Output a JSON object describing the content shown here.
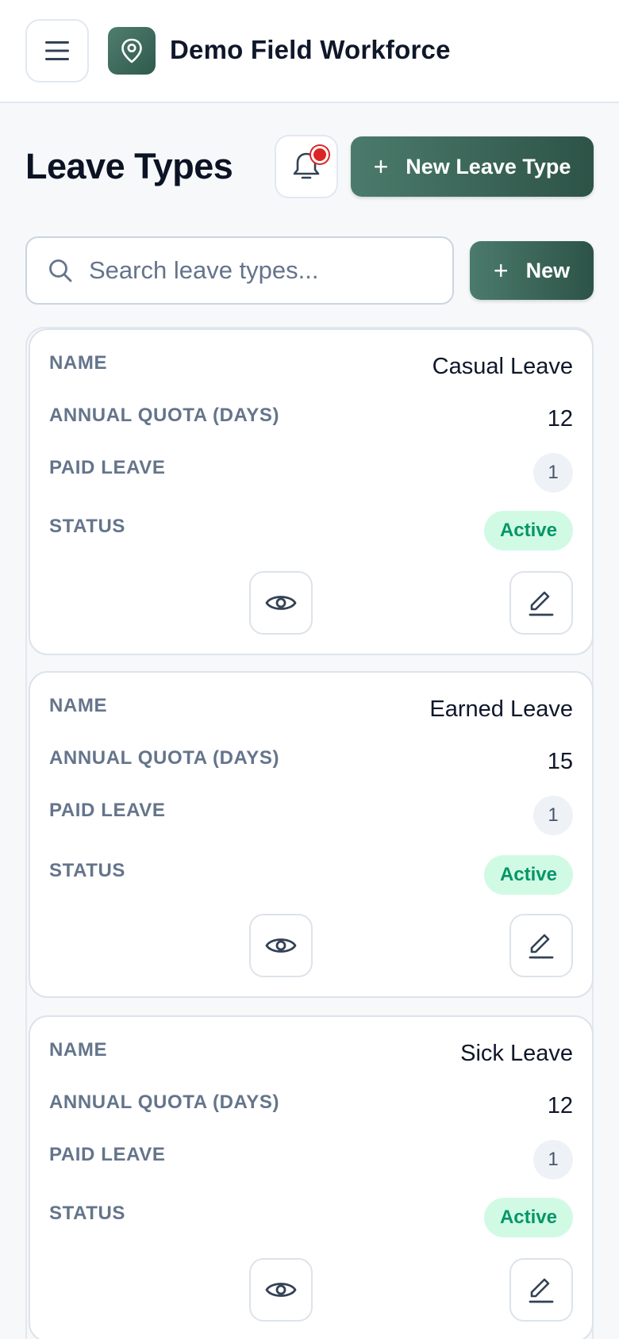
{
  "header": {
    "app_name": "Demo Field Workforce"
  },
  "page": {
    "title": "Leave Types",
    "new_leave_type_label": "New Leave Type",
    "new_label": "New",
    "plus_glyph": "+"
  },
  "search": {
    "placeholder": "Search leave types...",
    "value": ""
  },
  "fields": {
    "name": "NAME",
    "quota": "ANNUAL QUOTA (DAYS)",
    "paid": "PAID LEAVE",
    "status": "STATUS"
  },
  "leave_types": [
    {
      "name": "Casual Leave",
      "quota": "12",
      "paid": "1",
      "status": "Active"
    },
    {
      "name": "Earned Leave",
      "quota": "15",
      "paid": "1",
      "status": "Active"
    },
    {
      "name": "Sick Leave",
      "quota": "12",
      "paid": "1",
      "status": "Active"
    }
  ],
  "colors": {
    "brand": "#3d6a5c",
    "status_active_bg": "#d1fae5",
    "status_active_text": "#059669",
    "notification_dot": "#dc2626"
  },
  "icons": {
    "menu": "menu-icon",
    "logo": "location-pin-icon",
    "bell": "bell-icon",
    "search": "search-icon",
    "view": "eye-icon",
    "edit": "edit-icon"
  }
}
